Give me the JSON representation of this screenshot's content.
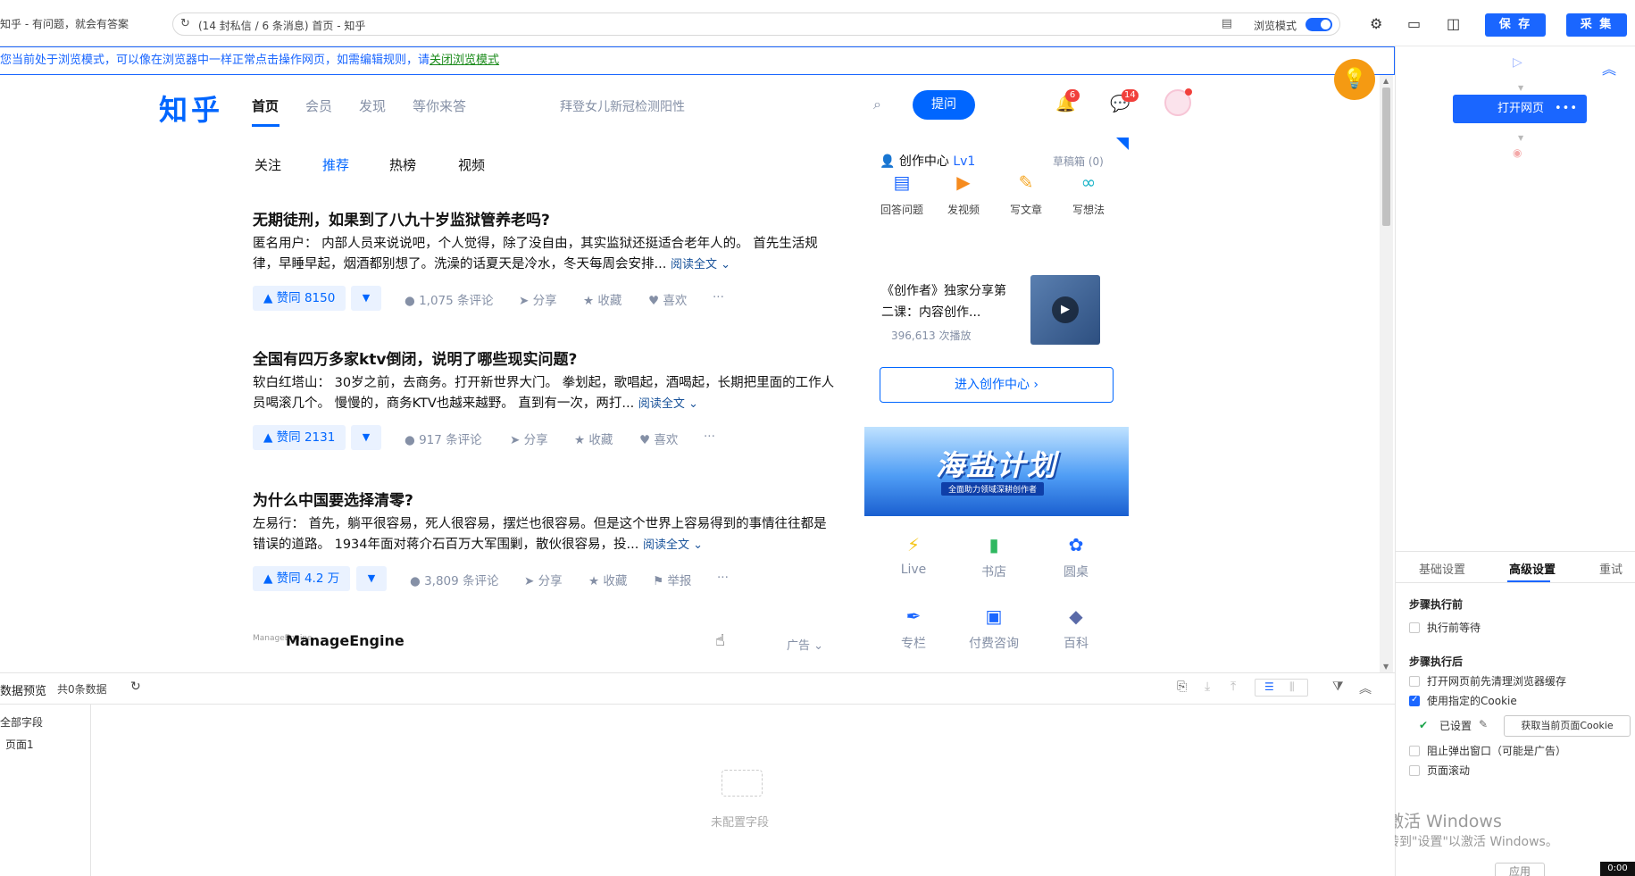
{
  "browser": {
    "tab_title": "知乎 - 有问题，就会有答案",
    "url": "(14 封私信 / 6 条消息) 首页 - 知乎",
    "mode_label": "浏览模式",
    "save_label": "保 存",
    "collect_label": "采 集"
  },
  "infobar": {
    "text": "您当前处于浏览模式，可以像在浏览器中一样正常点击操作网页，如需编辑规则，请",
    "link": "关闭浏览模式"
  },
  "zhihu": {
    "logo": "知乎",
    "nav": [
      "首页",
      "会员",
      "发现",
      "等你来答"
    ],
    "search_hint": "拜登女儿新冠检测阳性",
    "ask_label": "提问",
    "notif_count": "6",
    "msg_count": "14",
    "subtabs": [
      "关注",
      "推荐",
      "热榜",
      "视频"
    ],
    "feed": [
      {
        "title": "无期徒刑，如果到了八九十岁监狱管养老吗?",
        "body": "匿名用户： 内部人员来说说吧，个人觉得，除了没自由，其实监狱还挺适合老年人的。 首先生活规律，早睡早起，烟酒都别想了。洗澡的话夏天是冷水，冬天每周会安排...",
        "read_more": "阅读全文 ⌄",
        "vote": "▲ 赞同 8150",
        "comments": "1,075 条评论",
        "share": "分享",
        "fav": "收藏",
        "like": "喜欢"
      },
      {
        "title": "全国有四万多家ktv倒闭，说明了哪些现实问题?",
        "body": "软白红塔山： 30岁之前，去商务。打开新世界大门。 拳划起，歌唱起，酒喝起，长期把里面的工作人员喝滚几个。 慢慢的，商务KTV也越来越野。 直到有一次，两打...",
        "read_more": "阅读全文 ⌄",
        "vote": "▲ 赞同 2131",
        "comments": "917 条评论",
        "share": "分享",
        "fav": "收藏",
        "like": "喜欢"
      },
      {
        "title": "为什么中国要选择清零?",
        "body": "左易行： 首先，躺平很容易，死人很容易，摆烂也很容易。但是这个世界上容易得到的事情往往都是错误的道路。 1934年面对蒋介石百万大军围剿，散伙很容易，投...",
        "read_more": "阅读全文 ⌄",
        "vote": "▲ 赞同 4.2 万",
        "comments": "3,809 条评论",
        "share": "分享",
        "fav": "收藏",
        "like": "举报"
      }
    ],
    "ad_logo": "ManageEngine",
    "ad_name": "ManageEngine",
    "ad_tag": "广告 ⌄",
    "creator": {
      "title": "创作中心",
      "level": "Lv1",
      "drafts": "草稿箱 (0)",
      "tools": [
        "回答问题",
        "发视频",
        "写文章",
        "写想法"
      ],
      "course_title": "《创作者》独家分享第二课：内容创作...",
      "course_plays": "396,613 次播放",
      "enter": "进入创作中心 ›"
    },
    "banner_title": "海盐计划",
    "banner_sub": "全面助力领域深耕创作者",
    "entries": [
      "Live",
      "书店",
      "圆桌",
      "专栏",
      "付费咨询",
      "百科"
    ]
  },
  "right_panel": {
    "open_node": "打开网页",
    "tabs": [
      "基础设置",
      "高级设置",
      "重试"
    ],
    "before_hd": "步骤执行前",
    "before_opts": [
      "执行前等待"
    ],
    "after_hd": "步骤执行后",
    "after_opts": [
      "打开网页前先清理浏览器缓存",
      "使用指定的Cookie"
    ],
    "set_label": "已设置",
    "get_cookie": "获取当前页面Cookie",
    "more_opts": [
      "阻止弹出窗口（可能是广告）",
      "页面滚动"
    ],
    "win_mark1": "激活 Windows",
    "win_mark2": "转到\"设置\"以激活 Windows。",
    "apply": "应用",
    "time": "0:00"
  },
  "bottom_panel": {
    "title": "数据预览",
    "count": "共0条数据",
    "all_fields": "全部字段",
    "page1": "页面1",
    "empty": "未配置字段"
  },
  "colors": {
    "accent": "#1a66ff",
    "zhihu_blue": "#0066ff",
    "badge": "#f1403c"
  }
}
